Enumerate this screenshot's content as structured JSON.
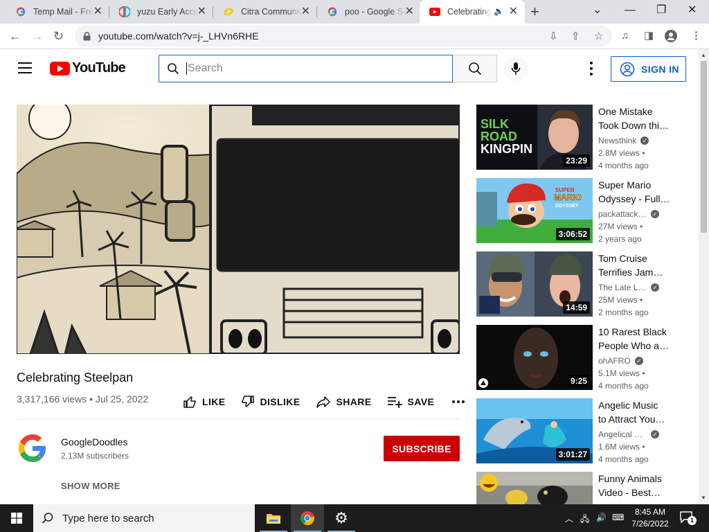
{
  "browser": {
    "tabs": [
      {
        "title": "Temp Mail - Fre",
        "favicon": "google-icon"
      },
      {
        "title": "yuzu Early Acce",
        "favicon": "yuzu-icon"
      },
      {
        "title": "Citra Communit",
        "favicon": "citra-icon"
      },
      {
        "title": "poo - Google Se",
        "favicon": "google-icon"
      },
      {
        "title": "Celebrating",
        "favicon": "youtube-icon",
        "active": true,
        "audio": true
      }
    ],
    "url": "youtube.com/watch?v=j-_LHVn6RHE"
  },
  "youtube": {
    "logo_text": "YouTube",
    "search_placeholder": "Search",
    "sign_in": "SIGN IN"
  },
  "video": {
    "title": "Celebrating Steelpan",
    "meta": "3,317,166 views • Jul 25, 2022",
    "actions": {
      "like": "LIKE",
      "dislike": "DISLIKE",
      "share": "SHARE",
      "save": "SAVE"
    },
    "channel": {
      "name": "GoogleDoodles",
      "subscribers": "2.13M subscribers"
    },
    "subscribe": "SUBSCRIBE",
    "show_more": "SHOW MORE"
  },
  "recommendations": [
    {
      "title1": "One Mistake",
      "title2": "Took Down thi…",
      "channel": "Newsthink",
      "verified": true,
      "views": "2.8M views •",
      "age": "4 months ago",
      "duration": "23:29",
      "thumb_text": [
        "SILK",
        "ROAD",
        "KINGPIN"
      ]
    },
    {
      "title1": "Super Mario",
      "title2": "Odyssey - Full…",
      "channel": "packattack0…",
      "verified": true,
      "views": "27M views •",
      "age": "2 years ago",
      "duration": "3:06:52",
      "thumb_text": [
        "SUPER",
        "MARIO",
        "ODYSSEY"
      ]
    },
    {
      "title1": "Tom Cruise",
      "title2": "Terrifies Jam…",
      "channel": "The Late La…",
      "verified": true,
      "views": "25M views •",
      "age": "2 months ago",
      "duration": "14:59"
    },
    {
      "title1": "10 Rarest Black",
      "title2": "People Who a…",
      "channel": "ohAFRO",
      "verified": true,
      "views": "5.1M views •",
      "age": "4 months ago",
      "duration": "9:25"
    },
    {
      "title1": "Angelic Music",
      "title2": "to Attract You…",
      "channel": "Angelical M…",
      "verified": true,
      "views": "1.6M views •",
      "age": "4 months ago",
      "duration": "3:01:27"
    },
    {
      "title1": "Funny Animals",
      "title2": "Video - Best…",
      "channel": "",
      "verified": false,
      "views": "",
      "age": "",
      "duration": ""
    }
  ],
  "taskbar": {
    "search_placeholder": "Type here to search",
    "time": "8:45 AM",
    "date": "7/26/2022",
    "notifications": "1"
  },
  "colors": {
    "yt_red": "#ff0000",
    "subscribe_red": "#cc0000",
    "link_blue": "#065fd4",
    "taskbar": "#1c1c1c"
  }
}
